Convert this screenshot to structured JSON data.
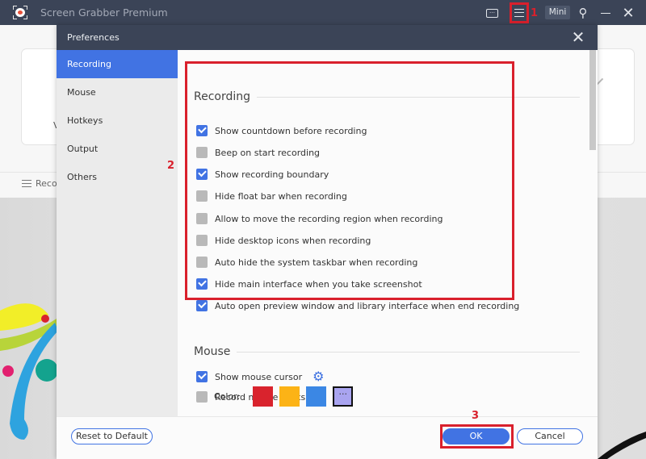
{
  "app": {
    "title": "Screen Grabber Premium",
    "mini_label": "Mini",
    "record_list_label": "Reco",
    "card_partial_text": "V"
  },
  "annotations": {
    "one": "1",
    "two": "2",
    "three": "3"
  },
  "icons": {
    "chat": "…",
    "pin": "⚲",
    "close": "✕",
    "gear": "⚙",
    "more": "···"
  },
  "dialog": {
    "title": "Preferences",
    "sidebar": [
      {
        "label": "Recording",
        "active": true
      },
      {
        "label": "Mouse",
        "active": false
      },
      {
        "label": "Hotkeys",
        "active": false
      },
      {
        "label": "Output",
        "active": false
      },
      {
        "label": "Others",
        "active": false
      }
    ],
    "recording": {
      "title": "Recording",
      "options": [
        {
          "label": "Show countdown before recording",
          "checked": true
        },
        {
          "label": "Beep on start recording",
          "checked": false
        },
        {
          "label": "Show recording boundary",
          "checked": true
        },
        {
          "label": "Hide float bar when recording",
          "checked": false
        },
        {
          "label": "Allow to move the recording region when recording",
          "checked": false
        },
        {
          "label": "Hide desktop icons when recording",
          "checked": false
        },
        {
          "label": "Auto hide the system taskbar when recording",
          "checked": false
        },
        {
          "label": "Hide main interface when you take screenshot",
          "checked": true
        },
        {
          "label": "Auto open preview window and library interface when end recording",
          "checked": true
        }
      ]
    },
    "mouse": {
      "title": "Mouse",
      "options": [
        {
          "label": "Show mouse cursor",
          "checked": true
        },
        {
          "label": "Record mouse clicks",
          "checked": false
        }
      ],
      "color_label": "Color:",
      "colors": [
        "#d9232d",
        "#fcb316",
        "#3b87e4",
        "#a9a4f0"
      ]
    },
    "footer": {
      "reset_label": "Reset to Default",
      "ok_label": "OK",
      "cancel_label": "Cancel"
    }
  },
  "colors": {
    "accent": "#4173e3",
    "header": "#3b4457",
    "annotation": "#d9202c"
  }
}
